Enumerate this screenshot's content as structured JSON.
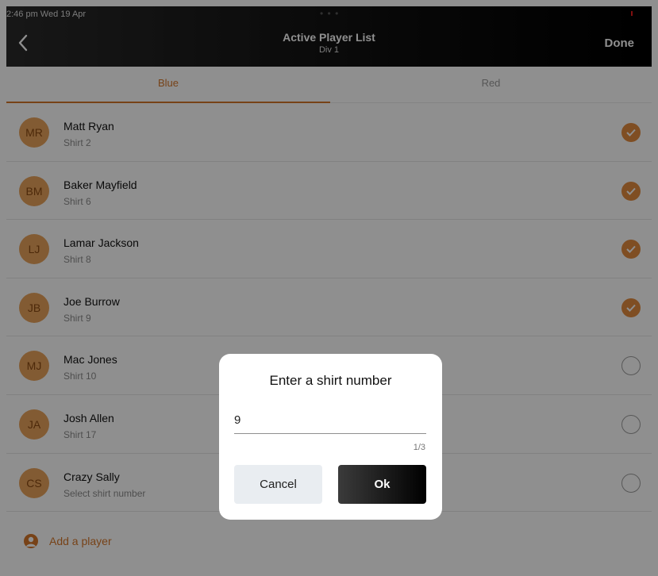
{
  "status": {
    "time": "2:46 pm  Wed 19 Apr",
    "dots": "• • •"
  },
  "header": {
    "title": "Active Player List",
    "subtitle": "Div 1",
    "done_label": "Done"
  },
  "tabs": [
    {
      "label": "Blue",
      "active": true
    },
    {
      "label": "Red",
      "active": false
    }
  ],
  "players": [
    {
      "initials": "MR",
      "name": "Matt Ryan",
      "shirt": "Shirt 2",
      "selected": true
    },
    {
      "initials": "BM",
      "name": "Baker Mayfield",
      "shirt": "Shirt 6",
      "selected": true
    },
    {
      "initials": "LJ",
      "name": "Lamar Jackson",
      "shirt": "Shirt 8",
      "selected": true
    },
    {
      "initials": "JB",
      "name": "Joe Burrow",
      "shirt": "Shirt 9",
      "selected": true
    },
    {
      "initials": "MJ",
      "name": "Mac Jones",
      "shirt": "Shirt 10",
      "selected": false
    },
    {
      "initials": "JA",
      "name": "Josh Allen",
      "shirt": "Shirt 17",
      "selected": false
    },
    {
      "initials": "CS",
      "name": "Crazy Sally",
      "shirt": "Select shirt number",
      "selected": false
    }
  ],
  "add_player": {
    "label": "Add a player",
    "icon": "person-circle-icon"
  },
  "dialog": {
    "title": "Enter a shirt number",
    "input_value": "9",
    "counter": "1/3",
    "cancel_label": "Cancel",
    "ok_label": "Ok"
  },
  "colors": {
    "accent": "#d4772a",
    "avatar": "#e8a35c",
    "check": "#e38b3f",
    "header": "#000000"
  }
}
